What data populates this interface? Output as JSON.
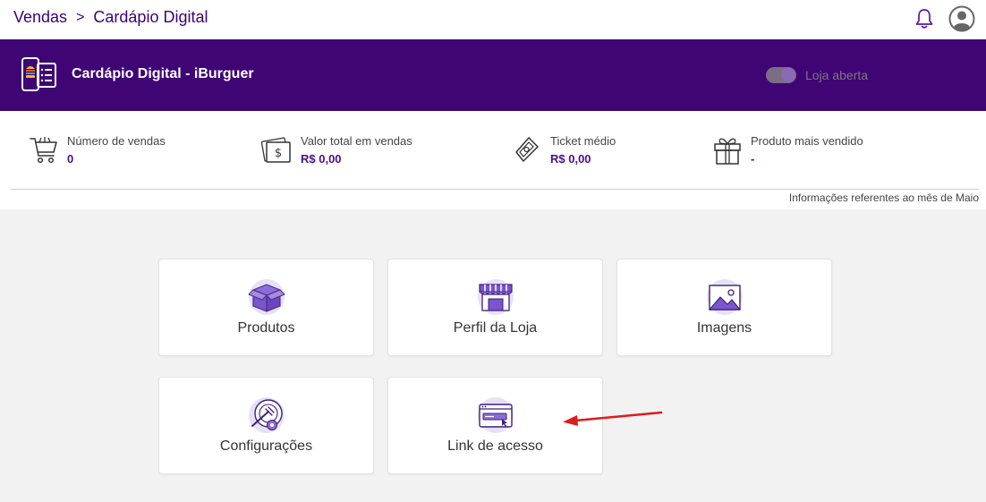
{
  "breadcrumb": {
    "root": "Vendas",
    "separator": ">",
    "current": "Cardápio Digital"
  },
  "header_icons": {
    "notifications": "bell-icon",
    "profile": "user-avatar-icon"
  },
  "store": {
    "title": "Cardápio Digital - iBurguer",
    "toggle_label": "Loja aberta",
    "toggle_on": true,
    "accent_color": "#3f0575"
  },
  "stats": [
    {
      "icon": "shopping-cart-icon",
      "label": "Número de vendas",
      "value": "0"
    },
    {
      "icon": "money-icon",
      "label": "Valor total em vendas",
      "value": "R$ 0,00"
    },
    {
      "icon": "ticket-icon",
      "label": "Ticket médio",
      "value": "R$ 0,00"
    },
    {
      "icon": "gift-icon",
      "label": "Produto mais vendido",
      "value": "-"
    }
  ],
  "info_note": "Informações referentes ao mês de Maio",
  "cards": [
    {
      "icon": "box-icon",
      "label": "Produtos"
    },
    {
      "icon": "storefront-icon",
      "label": "Perfil da Loja"
    },
    {
      "icon": "image-icon",
      "label": "Imagens"
    },
    {
      "icon": "settings-plate-icon",
      "label": "Configurações"
    },
    {
      "icon": "link-browser-icon",
      "label": "Link de acesso"
    }
  ]
}
